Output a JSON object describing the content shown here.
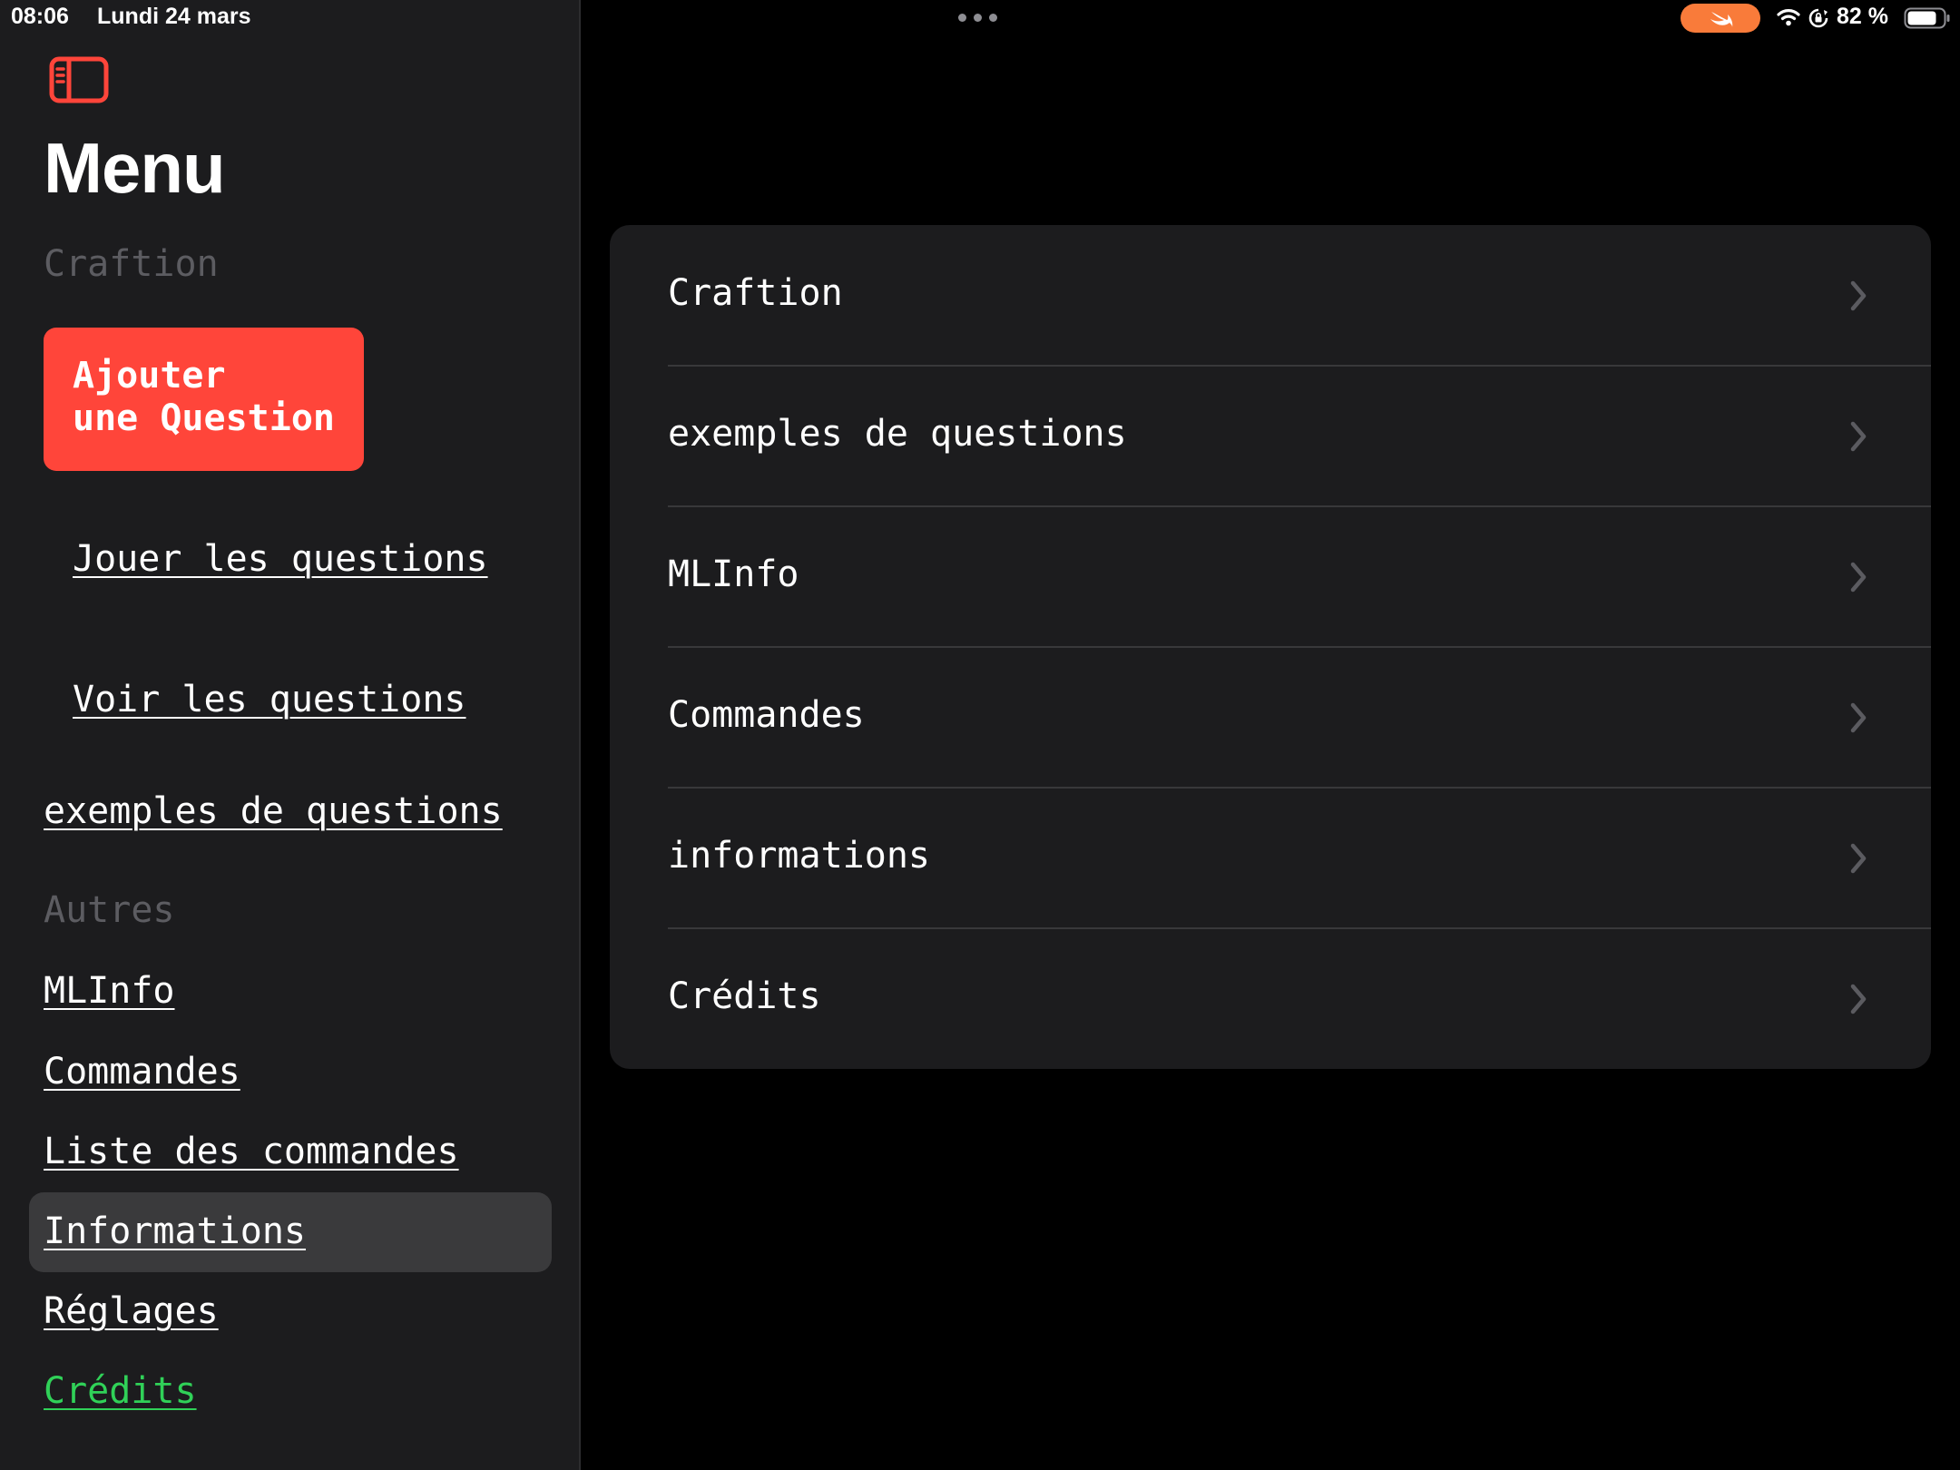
{
  "status_bar": {
    "time": "08:06",
    "date": "Lundi 24 mars",
    "battery_percent": "82 %",
    "icons": [
      "multitask-dots-icon",
      "swift-icon",
      "wifi-icon",
      "lock-rotation-icon",
      "battery-icon"
    ]
  },
  "sidebar": {
    "toggle_icon": "sidebar-toggle-icon",
    "title": "Menu",
    "section_craftion": "Craftion",
    "add_button": {
      "line1": "Ajouter",
      "line2": "une Question"
    },
    "links": {
      "jouer": "Jouer les questions",
      "voir": "Voir les questions",
      "exemples": "exemples de questions"
    },
    "section_autres": "Autres",
    "other_links": {
      "mlinfo": "MLInfo",
      "commandes": "Commandes",
      "liste": "Liste des commandes",
      "informations": "Informations",
      "reglages": "Réglages",
      "credits": "Crédits"
    },
    "selected_item": "Informations"
  },
  "main": {
    "rows": [
      "Craftion",
      "exemples de questions",
      "MLInfo",
      "Commandes",
      "informations",
      "Crédits"
    ]
  },
  "colors": {
    "accent_red": "#ff453a",
    "credits_green": "#30d158",
    "swift_orange": "#f97b3a",
    "sidebar_bg": "#1c1c1e",
    "selected_bg": "#3a3a3c"
  }
}
